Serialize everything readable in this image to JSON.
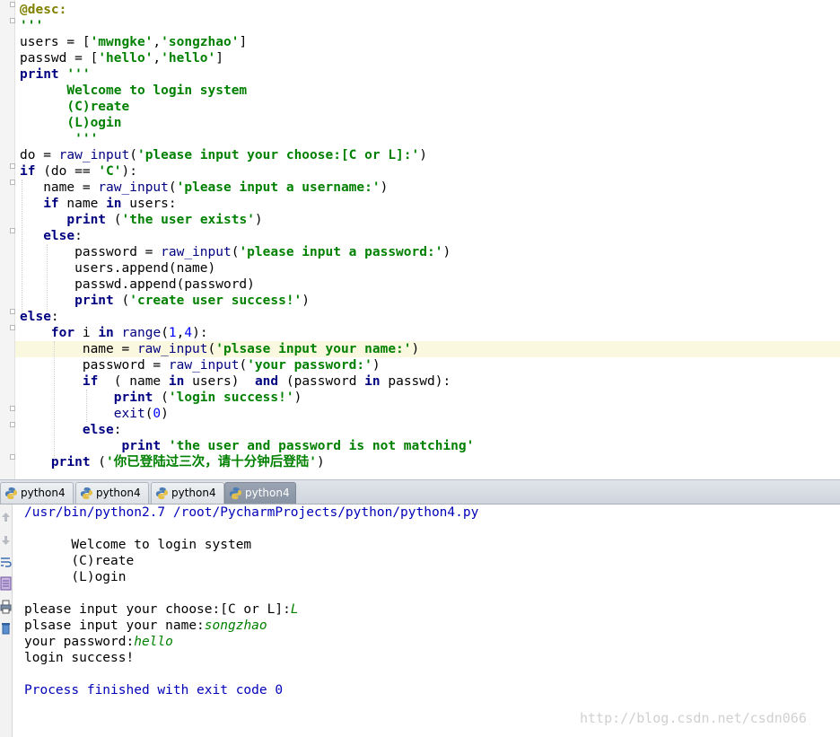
{
  "editor": {
    "lines": [
      [
        {
          "t": "@desc:",
          "c": "an"
        }
      ],
      [
        {
          "t": "'''",
          "c": "st"
        }
      ],
      [
        {
          "t": "users = ["
        },
        {
          "t": "'mwngke'",
          "c": "st"
        },
        {
          "t": ","
        },
        {
          "t": "'songzhao'",
          "c": "st"
        },
        {
          "t": "]"
        }
      ],
      [
        {
          "t": "passwd = ["
        },
        {
          "t": "'hello'",
          "c": "st"
        },
        {
          "t": ","
        },
        {
          "t": "'hello'",
          "c": "st"
        },
        {
          "t": "]"
        }
      ],
      [
        {
          "t": "print",
          "c": "kw"
        },
        {
          "t": " "
        },
        {
          "t": "'''",
          "c": "st"
        }
      ],
      [
        {
          "t": "      Welcome to login system",
          "c": "st"
        }
      ],
      [
        {
          "t": "      (C)reate",
          "c": "st"
        }
      ],
      [
        {
          "t": "      (L)ogin",
          "c": "st"
        }
      ],
      [
        {
          "t": "       '''",
          "c": "st"
        }
      ],
      [
        {
          "t": "do = "
        },
        {
          "t": "raw_input",
          "c": "bi"
        },
        {
          "t": "("
        },
        {
          "t": "'please input your choose:[C or L]:'",
          "c": "st"
        },
        {
          "t": ")"
        }
      ],
      [
        {
          "t": "if",
          "c": "kw"
        },
        {
          "t": " (do == "
        },
        {
          "t": "'C'",
          "c": "st"
        },
        {
          "t": "):"
        }
      ],
      [
        {
          "t": "   name = "
        },
        {
          "t": "raw_input",
          "c": "bi"
        },
        {
          "t": "("
        },
        {
          "t": "'please input a username:'",
          "c": "st"
        },
        {
          "t": ")"
        }
      ],
      [
        {
          "t": "   "
        },
        {
          "t": "if",
          "c": "kw"
        },
        {
          "t": " name "
        },
        {
          "t": "in",
          "c": "kw"
        },
        {
          "t": " users:"
        }
      ],
      [
        {
          "t": "      "
        },
        {
          "t": "print",
          "c": "kw"
        },
        {
          "t": " ("
        },
        {
          "t": "'the user exists'",
          "c": "st"
        },
        {
          "t": ")"
        }
      ],
      [
        {
          "t": "   "
        },
        {
          "t": "else",
          "c": "kw"
        },
        {
          "t": ":"
        }
      ],
      [
        {
          "t": "       password = "
        },
        {
          "t": "raw_input",
          "c": "bi"
        },
        {
          "t": "("
        },
        {
          "t": "'please input a password:'",
          "c": "st"
        },
        {
          "t": ")"
        }
      ],
      [
        {
          "t": "       users.append(name)"
        }
      ],
      [
        {
          "t": "       passwd.append(password)"
        }
      ],
      [
        {
          "t": "       "
        },
        {
          "t": "print",
          "c": "kw"
        },
        {
          "t": " ("
        },
        {
          "t": "'create user success!'",
          "c": "st"
        },
        {
          "t": ")"
        }
      ],
      [
        {
          "t": "else",
          "c": "kw"
        },
        {
          "t": ":"
        }
      ],
      [
        {
          "t": "    "
        },
        {
          "t": "for",
          "c": "kw"
        },
        {
          "t": " i "
        },
        {
          "t": "in",
          "c": "kw"
        },
        {
          "t": " "
        },
        {
          "t": "range",
          "c": "bi"
        },
        {
          "t": "("
        },
        {
          "t": "1",
          "c": "nm"
        },
        {
          "t": ","
        },
        {
          "t": "4",
          "c": "nm"
        },
        {
          "t": "):"
        }
      ],
      [
        {
          "t": "        name = "
        },
        {
          "t": "raw_input",
          "c": "bi"
        },
        {
          "t": "("
        },
        {
          "t": "'plsase input your name:'",
          "c": "st"
        },
        {
          "t": ")"
        }
      ],
      [
        {
          "t": "        password = "
        },
        {
          "t": "raw_input",
          "c": "bi"
        },
        {
          "t": "("
        },
        {
          "t": "'your password:'",
          "c": "st"
        },
        {
          "t": ")"
        }
      ],
      [
        {
          "t": "        "
        },
        {
          "t": "if",
          "c": "kw"
        },
        {
          "t": "  ( name "
        },
        {
          "t": "in",
          "c": "kw"
        },
        {
          "t": " users)  "
        },
        {
          "t": "and",
          "c": "kw"
        },
        {
          "t": " (password "
        },
        {
          "t": "in",
          "c": "kw"
        },
        {
          "t": " passwd):"
        }
      ],
      [
        {
          "t": "            "
        },
        {
          "t": "print",
          "c": "kw"
        },
        {
          "t": " ("
        },
        {
          "t": "'login success!'",
          "c": "st"
        },
        {
          "t": ")"
        }
      ],
      [
        {
          "t": "            "
        },
        {
          "t": "exit",
          "c": "bi"
        },
        {
          "t": "("
        },
        {
          "t": "0",
          "c": "nm"
        },
        {
          "t": ")"
        }
      ],
      [
        {
          "t": "        "
        },
        {
          "t": "else",
          "c": "kw"
        },
        {
          "t": ":"
        }
      ],
      [
        {
          "t": "             "
        },
        {
          "t": "print",
          "c": "kw"
        },
        {
          "t": " "
        },
        {
          "t": "'the user and password is not matching'",
          "c": "st"
        }
      ],
      [
        {
          "t": "    "
        },
        {
          "t": "print",
          "c": "kw"
        },
        {
          "t": " ("
        },
        {
          "t": "'你已登陆过三次，请十分钟后登陆'",
          "c": "st"
        },
        {
          "t": ")"
        }
      ]
    ]
  },
  "run_tabs": [
    {
      "label": "python4",
      "active": false
    },
    {
      "label": "python4",
      "active": false
    },
    {
      "label": "python4",
      "active": false
    },
    {
      "label": "python4",
      "active": true
    }
  ],
  "toolbar_icons": [
    "arrow-up-icon",
    "arrow-down-icon",
    "soft-wrap-icon",
    "scroll-to-end-icon",
    "print-icon",
    "trash-icon"
  ],
  "console": {
    "lines": [
      [
        {
          "t": "/usr/bin/python2.7 /root/PycharmProjects/python/python4.py",
          "c": "blue"
        }
      ],
      [],
      [
        {
          "t": "      Welcome to login system"
        }
      ],
      [
        {
          "t": "      (C)reate"
        }
      ],
      [
        {
          "t": "      (L)ogin"
        }
      ],
      [],
      [
        {
          "t": "please input your choose:[C or L]:"
        },
        {
          "t": "L",
          "c": "inp"
        }
      ],
      [
        {
          "t": "plsase input your name:"
        },
        {
          "t": "songzhao",
          "c": "inp"
        }
      ],
      [
        {
          "t": "your password:"
        },
        {
          "t": "hello",
          "c": "inp"
        }
      ],
      [
        {
          "t": "login success!"
        }
      ],
      [],
      [
        {
          "t": "Process finished with exit code 0",
          "c": "blue"
        }
      ]
    ]
  },
  "watermark": "http://blog.csdn.net/csdn066",
  "colors": {
    "keyword": "#000080",
    "string": "#008000",
    "number": "#0000ff",
    "current_line": "#fbf8e0",
    "console_info": "#0000b8"
  }
}
